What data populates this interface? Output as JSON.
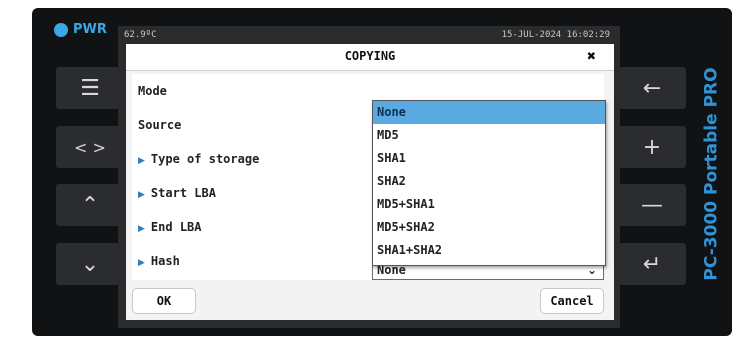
{
  "device": {
    "pwr_label": "PWR",
    "brand": "PC-3000 Portable PRO",
    "buttons_left": [
      {
        "name": "menu-button",
        "icon": "hamburger-icon",
        "glyph": "☰"
      },
      {
        "name": "left-right-button",
        "icon": "chevrons-left-right-icon",
        "glyph": "< >"
      },
      {
        "name": "up-button",
        "icon": "chevron-up-icon",
        "glyph": "⌃"
      },
      {
        "name": "down-button",
        "icon": "chevron-down-icon",
        "glyph": "⌄"
      }
    ],
    "buttons_right": [
      {
        "name": "back-button",
        "icon": "arrow-left-icon",
        "glyph": "←"
      },
      {
        "name": "plus-button",
        "icon": "plus-icon",
        "glyph": "+"
      },
      {
        "name": "minus-button",
        "icon": "minus-icon",
        "glyph": "—"
      },
      {
        "name": "enter-button",
        "icon": "enter-icon",
        "glyph": "↵"
      }
    ]
  },
  "status": {
    "temperature": "62.9ºC",
    "datetime": "15-JUL-2024 16:02:29"
  },
  "dialog": {
    "title": "COPYING",
    "close": "✖",
    "fields": {
      "mode": "Mode",
      "source": "Source",
      "type_of_storage": "Type of storage",
      "start_lba": "Start LBA",
      "end_lba": "End LBA",
      "hash": "Hash"
    },
    "hash_value": "None",
    "dropdown_options": [
      "None",
      "MD5",
      "SHA1",
      "SHA2",
      "MD5+SHA1",
      "MD5+SHA2",
      "SHA1+SHA2"
    ],
    "selected_option": "None",
    "ok": "OK",
    "cancel": "Cancel"
  },
  "colors": {
    "accent": "#3aa7e6",
    "selection": "#5aa9e0"
  }
}
